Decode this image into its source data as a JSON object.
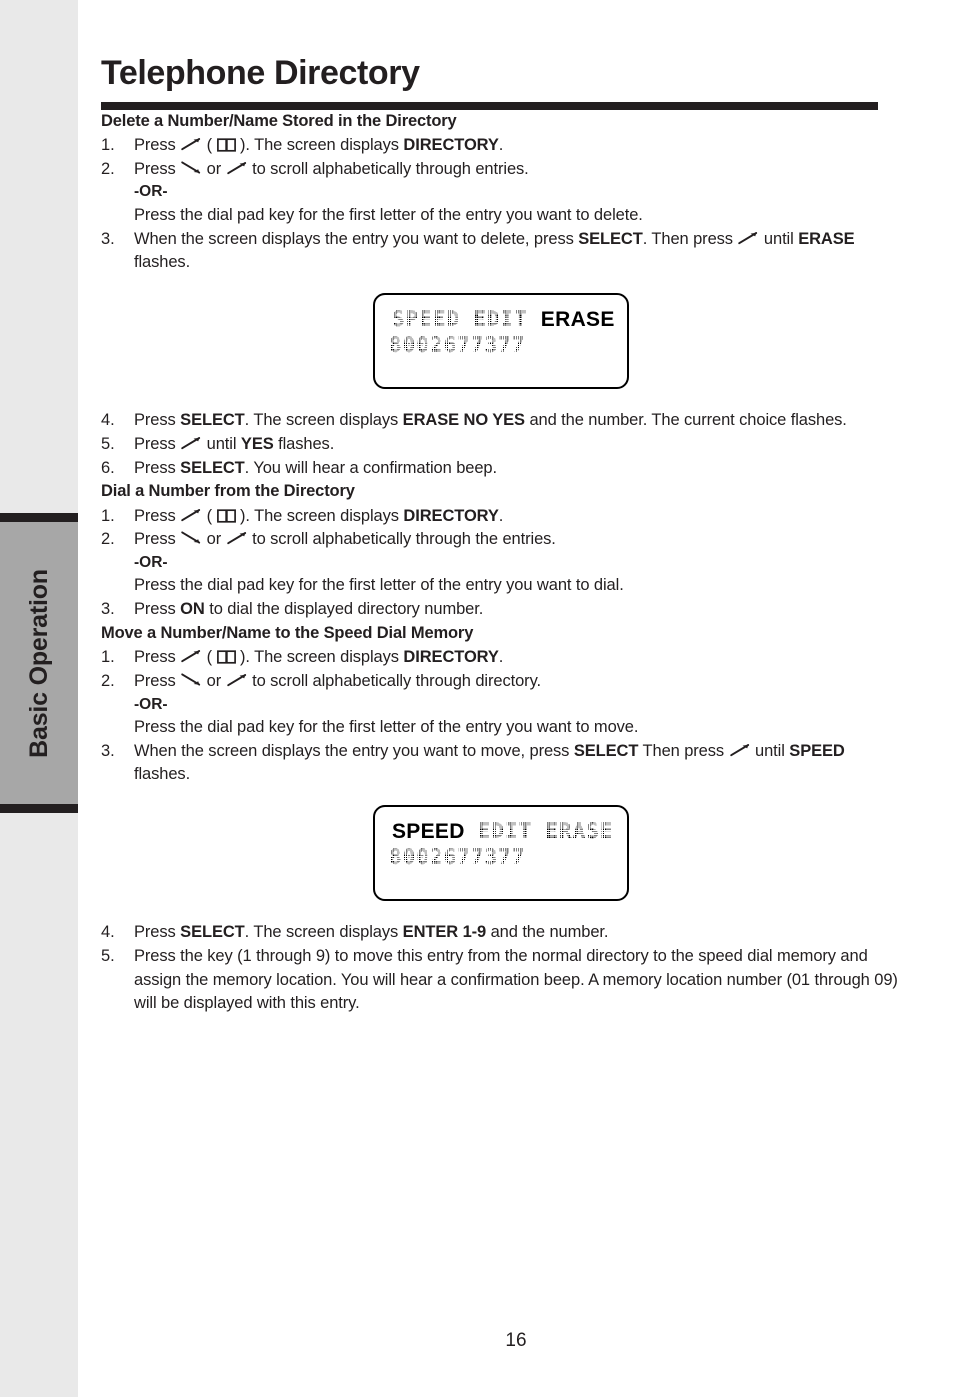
{
  "sidebar": {
    "tab_label": "Basic Operation"
  },
  "page": {
    "title": "Telephone Directory",
    "number": "16"
  },
  "sections": [
    {
      "heading": "Delete a Number/Name Stored in the Directory",
      "steps": [
        {
          "num": "1.",
          "parts": [
            {
              "t": "text",
              "v": "Press "
            },
            {
              "t": "icon",
              "v": "arrow-up-right-icon"
            },
            {
              "t": "text",
              "v": " ( "
            },
            {
              "t": "icon",
              "v": "open-book-icon"
            },
            {
              "t": "text",
              "v": " ). The screen displays "
            },
            {
              "t": "bold",
              "v": "DIRECTORY"
            },
            {
              "t": "text",
              "v": "."
            }
          ]
        },
        {
          "num": "2.",
          "parts": [
            {
              "t": "text",
              "v": "Press "
            },
            {
              "t": "icon",
              "v": "arrow-down-right-icon"
            },
            {
              "t": "text",
              "v": " or "
            },
            {
              "t": "icon",
              "v": "arrow-up-right-icon"
            },
            {
              "t": "text",
              "v": " to scroll alphabetically through entries."
            }
          ],
          "sub": [
            {
              "style": "or",
              "v": "-OR-"
            },
            {
              "style": "normal",
              "v": "Press the dial pad key for the first letter of the entry you want to delete."
            }
          ]
        },
        {
          "num": "3.",
          "parts": [
            {
              "t": "text",
              "v": "When the screen displays the entry you want to delete, press "
            },
            {
              "t": "bold",
              "v": "SELECT"
            },
            {
              "t": "text",
              "v": ". Then press "
            },
            {
              "t": "icon",
              "v": "arrow-up-right-icon"
            },
            {
              "t": "break",
              "v": ""
            },
            {
              "t": "text",
              "v": " until "
            },
            {
              "t": "bold",
              "v": "ERASE"
            },
            {
              "t": "text",
              "v": " flashes."
            }
          ]
        }
      ],
      "figure": {
        "name": "lcd-display-erase",
        "line1": [
          {
            "style": "dot",
            "v": "SPEED"
          },
          {
            "style": "gap",
            "v": ""
          },
          {
            "style": "dot",
            "v": "EDIT"
          },
          {
            "style": "gap",
            "v": ""
          },
          {
            "style": "solid",
            "v": "ERASE"
          }
        ],
        "line2": [
          {
            "style": "dot",
            "v": "8002677377"
          }
        ]
      },
      "steps_after": [
        {
          "num": "4.",
          "parts": [
            {
              "t": "text",
              "v": "Press "
            },
            {
              "t": "bold",
              "v": "SELECT"
            },
            {
              "t": "text",
              "v": ". The screen displays "
            },
            {
              "t": "bold",
              "v": "ERASE NO YES"
            },
            {
              "t": "text",
              "v": " and the number. The current choice flashes."
            }
          ]
        },
        {
          "num": "5.",
          "parts": [
            {
              "t": "text",
              "v": "Press "
            },
            {
              "t": "icon",
              "v": "arrow-up-right-icon"
            },
            {
              "t": "text",
              "v": " until "
            },
            {
              "t": "bold",
              "v": "YES"
            },
            {
              "t": "text",
              "v": " flashes."
            }
          ]
        },
        {
          "num": "6.",
          "parts": [
            {
              "t": "text",
              "v": "Press "
            },
            {
              "t": "bold",
              "v": "SELECT"
            },
            {
              "t": "text",
              "v": ". You will hear a confirmation beep."
            }
          ]
        }
      ]
    },
    {
      "heading": "Dial a Number from the Directory",
      "steps": [
        {
          "num": "1.",
          "parts": [
            {
              "t": "text",
              "v": "Press "
            },
            {
              "t": "icon",
              "v": "arrow-up-right-icon"
            },
            {
              "t": "text",
              "v": " ( "
            },
            {
              "t": "icon",
              "v": "open-book-icon"
            },
            {
              "t": "text",
              "v": " ). The screen displays "
            },
            {
              "t": "bold",
              "v": "DIRECTORY"
            },
            {
              "t": "text",
              "v": "."
            }
          ]
        },
        {
          "num": "2.",
          "parts": [
            {
              "t": "text",
              "v": "Press "
            },
            {
              "t": "icon",
              "v": "arrow-down-right-icon"
            },
            {
              "t": "text",
              "v": " or "
            },
            {
              "t": "icon",
              "v": "arrow-up-right-icon"
            },
            {
              "t": "text",
              "v": " to scroll alphabetically through the entries."
            }
          ],
          "sub": [
            {
              "style": "or",
              "v": "-OR-"
            },
            {
              "style": "normal",
              "v": "Press the dial pad key for the first letter of the entry you want to dial."
            }
          ]
        },
        {
          "num": "3.",
          "parts": [
            {
              "t": "text",
              "v": "Press "
            },
            {
              "t": "bold",
              "v": "ON"
            },
            {
              "t": "text",
              "v": " to dial the displayed directory number."
            }
          ]
        }
      ]
    },
    {
      "heading": "Move a Number/Name to the Speed Dial Memory",
      "steps": [
        {
          "num": "1.",
          "parts": [
            {
              "t": "text",
              "v": "Press "
            },
            {
              "t": "icon",
              "v": "arrow-up-right-icon"
            },
            {
              "t": "text",
              "v": " ( "
            },
            {
              "t": "icon",
              "v": "open-book-icon"
            },
            {
              "t": "text",
              "v": " ). The screen displays "
            },
            {
              "t": "bold",
              "v": "DIRECTORY"
            },
            {
              "t": "text",
              "v": "."
            }
          ]
        },
        {
          "num": "2.",
          "parts": [
            {
              "t": "text",
              "v": "Press "
            },
            {
              "t": "icon",
              "v": "arrow-down-right-icon"
            },
            {
              "t": "text",
              "v": " or "
            },
            {
              "t": "icon",
              "v": "arrow-up-right-icon"
            },
            {
              "t": "text",
              "v": "  to scroll alphabetically through directory."
            }
          ],
          "sub": [
            {
              "style": "or",
              "v": "-OR-"
            },
            {
              "style": "normal",
              "v": "Press the dial pad key for the first letter of the entry you want to move."
            }
          ]
        },
        {
          "num": "3.",
          "parts": [
            {
              "t": "text",
              "v": "When the screen displays the entry you want to move, press "
            },
            {
              "t": "bold",
              "v": "SELECT"
            },
            {
              "t": "text",
              "v": " Then press "
            },
            {
              "t": "icon",
              "v": "arrow-up-right-icon"
            },
            {
              "t": "text",
              "v": " until "
            },
            {
              "t": "break",
              "v": ""
            },
            {
              "t": "bold",
              "v": "SPEED"
            },
            {
              "t": "text",
              "v": " flashes."
            }
          ]
        }
      ],
      "figure": {
        "name": "lcd-display-speed",
        "line1": [
          {
            "style": "solid",
            "v": "SPEED"
          },
          {
            "style": "gap",
            "v": ""
          },
          {
            "style": "dot",
            "v": "EDIT"
          },
          {
            "style": "gap",
            "v": ""
          },
          {
            "style": "dot",
            "v": "ERASE"
          }
        ],
        "line2": [
          {
            "style": "dot",
            "v": "8002677377"
          }
        ]
      },
      "steps_after": [
        {
          "num": "4.",
          "parts": [
            {
              "t": "text",
              "v": "Press "
            },
            {
              "t": "bold",
              "v": "SELECT"
            },
            {
              "t": "text",
              "v": ". The screen displays "
            },
            {
              "t": "bold",
              "v": "ENTER 1-9"
            },
            {
              "t": "text",
              "v": " and the number."
            }
          ]
        },
        {
          "num": "5.",
          "parts": [
            {
              "t": "text",
              "v": "Press the key (1 through 9) to move this entry from the normal directory to the speed dial memory and assign the memory location. You will hear a confirmation beep. A memory location number (01 through 09) will be displayed with this entry."
            }
          ]
        }
      ]
    }
  ]
}
